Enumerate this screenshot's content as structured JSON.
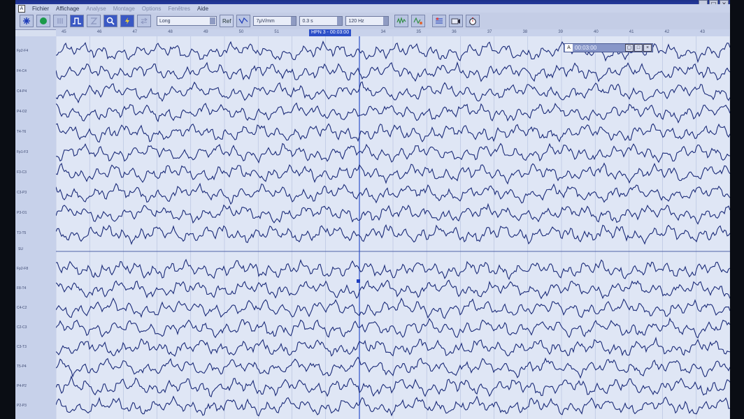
{
  "menu": {
    "app_icon": "A",
    "items": [
      "Fichier",
      "Affichage",
      "Analyse",
      "Montage",
      "Options",
      "Fenêtres",
      "Aide"
    ]
  },
  "window_buttons": [
    "_",
    "□",
    "×"
  ],
  "toolbar": {
    "montage_value": "Long",
    "ref_label": "Ref",
    "sensitivity_value": "7μV/mm",
    "time_constant_value": "0.3 s",
    "high_filter_value": "120 Hz"
  },
  "marker_label": "HPN 3 - 00:03:00",
  "ruler_ticks": [
    "45",
    "46",
    "47",
    "48",
    "49",
    "50",
    "51",
    "",
    "",
    "34",
    "35",
    "36",
    "37",
    "38",
    "39",
    "40",
    "41",
    "42",
    "43"
  ],
  "timer": {
    "icon": "A",
    "value": "00:03:00",
    "buttons": [
      "▢",
      "□",
      "×"
    ]
  },
  "channels_top": [
    "Fp2-F4",
    "F4-C4",
    "C4-P4",
    "P4-O2",
    "T4-T6",
    "Fp1-F3",
    "F3-C3",
    "C3-P3",
    "P3-O1",
    "T3-T5"
  ],
  "separator_label": "SU",
  "channels_bottom": [
    "Fp2-F8",
    "F8-T4",
    "C4-C2",
    "C2-C3",
    "C3-T3",
    "T5-P4",
    "P4-P2",
    "P2-P3"
  ],
  "colors": {
    "trace": "#1a2a78",
    "grid": "#a9b6d8",
    "screen_bg": "#dfe6f5",
    "toolbar_bg": "#c4cde6",
    "accent": "#2c4fc8"
  }
}
